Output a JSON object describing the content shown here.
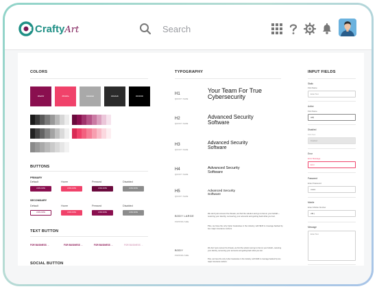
{
  "header": {
    "logo_main": "Crafty",
    "logo_accent": "Art",
    "search_placeholder": "Search"
  },
  "colors": {
    "title": "COLORS",
    "swatches": [
      {
        "label": "#8a0f4f",
        "color": "#8a0f4f"
      },
      {
        "label": "#f0426a",
        "color": "#f0426a"
      },
      {
        "label": "#a9a9a9",
        "color": "#a9a9a9"
      },
      {
        "label": "#2b2b2b",
        "color": "#2b2b2b"
      },
      {
        "label": "#000000",
        "color": "#000000"
      }
    ]
  },
  "buttons": {
    "title": "BUTTONS",
    "primary_label": "PRIMARY",
    "secondary_label": "SECONDARY",
    "states": [
      "Default",
      "Hover",
      "Pressed",
      "Disabled"
    ],
    "join_label": "JOIN NOW"
  },
  "text_button": {
    "title": "TEXT BUTTON",
    "label": "FOR BUSINESS →"
  },
  "social_button": {
    "title": "SOCIAL BUTTON"
  },
  "typography": {
    "title": "TYPOGRAPHY",
    "font_name": "QUICKY SAFE",
    "h1": {
      "tag": "H1",
      "sample": "Your Team For True Cybersecurity"
    },
    "h2": {
      "tag": "H2",
      "sample": "Advanced Security Software"
    },
    "h3": {
      "tag": "H3",
      "sample": "Advanced Security Software"
    },
    "h4": {
      "tag": "H4",
      "sample": "Advanced Security Software"
    },
    "h5": {
      "tag": "H5",
      "sample": "Advanced Security Software"
    },
    "body_large": {
      "tag": "BODY LARGE",
      "sub": "POPPINS SIZE",
      "p1": "We don't just uncover the threats, we find the solution and go to bat on your behalf—restoring your identity, recovering your accounts and getting back what you lost.",
      "p2": "Plus, we have the only Cyber Guarantee in the industry, with $1M in coverage backed by two major insurance carriers."
    },
    "body": {
      "tag": "BODY",
      "sub": "POPPINS SIZE",
      "p1": "We don't just uncover the threats, we find the solution and go to bat on your behalf—restoring your identity, recovering your accounts and getting back what you lost.",
      "p2": "Plus, we have the only Cyber Guarantee in the industry, with $1M in coverage backed by two major insurance carriers."
    }
  },
  "input_fields": {
    "title": "INPUT FIELDS",
    "fields": [
      {
        "state": "Static",
        "caption": "First Name",
        "value": "Enter Text"
      },
      {
        "state": "Active",
        "caption": "First Name",
        "value": "Jeff|"
      },
      {
        "state": "Disabled",
        "caption": "First Text",
        "value": "Disabled"
      },
      {
        "state": "Error",
        "caption": "Error Message",
        "value": "Error"
      },
      {
        "state": "Password",
        "caption": "Enter Password",
        "value": "••••••••"
      },
      {
        "state": "Mobile",
        "caption": "Enter Mobile Number",
        "value": "+91 |"
      }
    ],
    "message_label": "Message",
    "message_placeholder": "Enter Text"
  },
  "accent": "#8a0f4f",
  "accent_pink": "#f0426a"
}
